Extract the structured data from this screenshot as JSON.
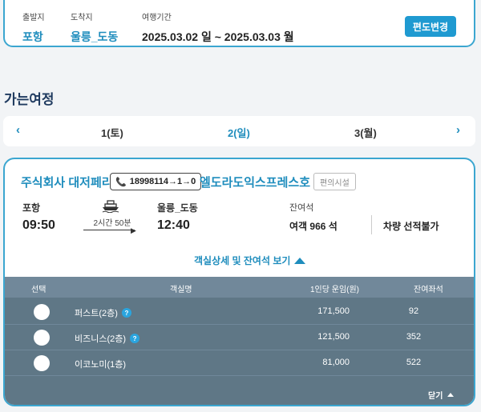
{
  "summary": {
    "departure_label": "출발지",
    "departure": "포항",
    "arrival_label": "도착지",
    "arrival": "울릉_도동",
    "period_label": "여행기간",
    "period": "2025.03.02 일 ~ 2025.03.03 월",
    "change_button": "편도변경"
  },
  "section_title": "가는여정",
  "date_nav": {
    "prev_icon": "‹",
    "next_icon": "›",
    "dates": [
      "1(토)",
      "2(일)",
      "3(월)"
    ],
    "active_index": 1
  },
  "trip": {
    "company": "주식회사 대저페리",
    "phone": "18998114→1→0",
    "vessel": "엘도라도익스프레스호",
    "facility_button": "편의시설",
    "from_port": "포항",
    "from_time": "09:50",
    "duration": "2시간 50분",
    "to_port": "울릉_도동",
    "to_time": "12:40",
    "remaining_label": "잔여석",
    "passenger_seats": "여객 966 석",
    "vehicle_seats": "차량 선적불가",
    "detail_toggle": "객실상세 및 잔여석 보기"
  },
  "cabin_table": {
    "headers": {
      "select": "선택",
      "cabin": "객실명",
      "fare": "1인당 운임(원)",
      "remaining": "잔여좌석"
    },
    "rows": [
      {
        "cabin": "퍼스트(2층)",
        "info": "?",
        "fare": "171,500",
        "remaining": "92"
      },
      {
        "cabin": "비즈니스(2층)",
        "info": "?",
        "fare": "121,500",
        "remaining": "352"
      },
      {
        "cabin": "이코노미(1층)",
        "fare": "81,000",
        "remaining": "522"
      }
    ],
    "close_button": "닫기"
  },
  "colors": {
    "accent": "#1f8dbd",
    "button": "#1f9ad1",
    "table_bg": "#5f7786",
    "table_header": "#71889a"
  }
}
